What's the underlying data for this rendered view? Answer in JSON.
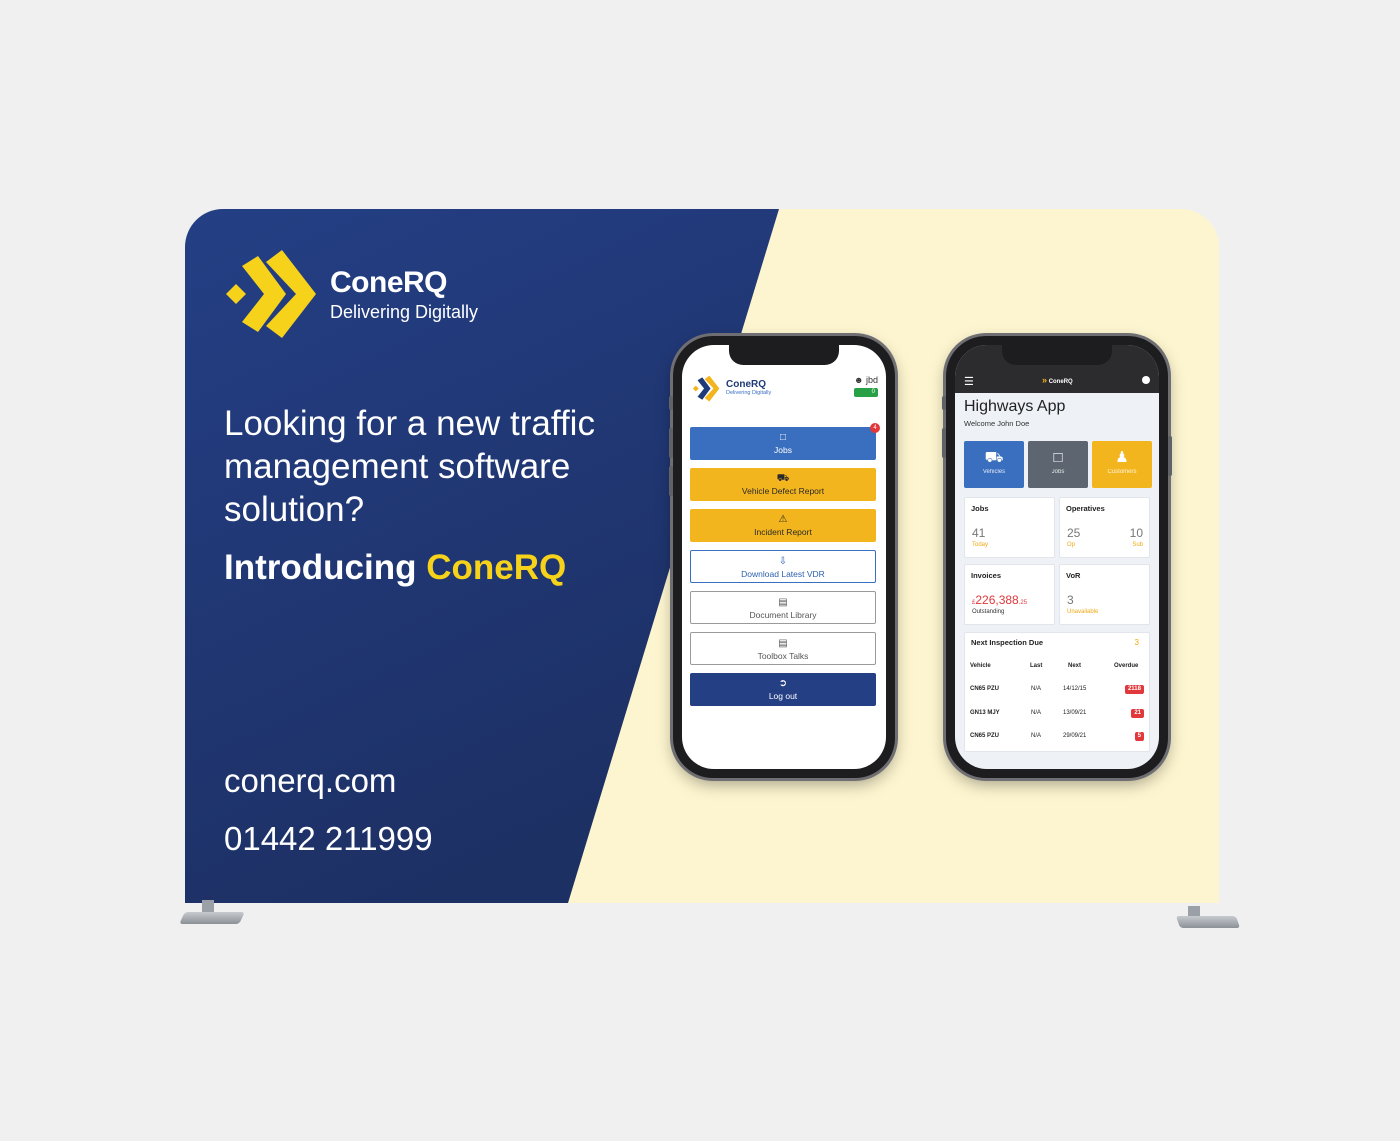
{
  "brand": {
    "name": "ConeRQ",
    "tagline": "Delivering Digitally",
    "colors": {
      "navy": "#1e3a78",
      "yellow": "#f6d21b",
      "cream": "#fdf5cf"
    }
  },
  "headline": "Looking for a new traffic management software solution?",
  "intro": {
    "prefix": "Introducing",
    "brand": "ConeRQ"
  },
  "contact": {
    "url": "conerq.com",
    "phone": "01442 211999"
  },
  "phone1": {
    "logo_name": "ConeRQ",
    "logo_tag": "Delivering Digitally",
    "user": "jbd",
    "badge_count": "0",
    "menu": [
      {
        "label": "Jobs",
        "icon": "clipboard-icon",
        "badge": "4"
      },
      {
        "label": "Vehicle Defect Report",
        "icon": "truck-icon"
      },
      {
        "label": "Incident Report",
        "icon": "car-crash-icon"
      },
      {
        "label": "Download Latest VDR",
        "icon": "download-file-icon"
      },
      {
        "label": "Document Library",
        "icon": "document-icon"
      },
      {
        "label": "Toolbox Talks",
        "icon": "document-icon"
      },
      {
        "label": "Log out",
        "icon": "logout-icon"
      }
    ]
  },
  "phone2": {
    "logo_name": "ConeRQ",
    "title": "Highways App",
    "welcome": "Welcome John Doe",
    "tiles": [
      {
        "label": "Vehicles",
        "icon": "truck-icon",
        "color": "#3a6fbf"
      },
      {
        "label": "Jobs",
        "icon": "clipboard-icon",
        "color": "#5d6670"
      },
      {
        "label": "Customers",
        "icon": "users-icon",
        "color": "#f3b51d"
      }
    ],
    "cards": {
      "jobs": {
        "title": "Jobs",
        "value": "41",
        "caption": "Today"
      },
      "operatives": {
        "title": "Operatives",
        "op_value": "25",
        "op_caption": "Op",
        "sub_value": "10",
        "sub_caption": "Sub"
      },
      "invoices": {
        "title": "Invoices",
        "currency": "£",
        "value": "226,388",
        "pence": ".25",
        "caption": "Outstanding"
      },
      "vor": {
        "title": "VoR",
        "value": "3",
        "caption": "Unavailable"
      }
    },
    "inspection": {
      "title": "Next Inspection Due",
      "count": "3",
      "columns": [
        "Vehicle",
        "Last",
        "Next",
        "Overdue"
      ],
      "rows": [
        {
          "vehicle": "CN65 PZU",
          "last": "N/A",
          "next": "14/12/15",
          "overdue": "2118"
        },
        {
          "vehicle": "GN13 MJY",
          "last": "N/A",
          "next": "13/09/21",
          "overdue": "21"
        },
        {
          "vehicle": "CN65 PZU",
          "last": "N/A",
          "next": "29/09/21",
          "overdue": "5"
        }
      ]
    }
  }
}
